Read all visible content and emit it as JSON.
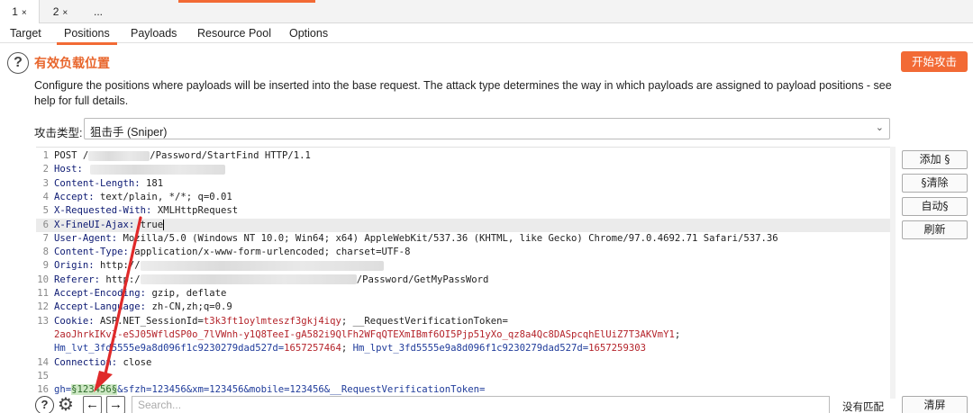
{
  "request_tabs": [
    {
      "label": "1",
      "close": "×"
    },
    {
      "label": "2",
      "close": "×"
    },
    {
      "label": "..."
    }
  ],
  "sub_tabs": [
    "Target",
    "Positions",
    "Payloads",
    "Resource Pool",
    "Options"
  ],
  "active_sub_tab": "Positions",
  "header": {
    "help_glyph": "?",
    "title": "有效负载位置",
    "start_button": "开始攻击",
    "description": "Configure the positions where payloads will be inserted into the base request. The attack type determines the way in which payloads are assigned to payload positions - see help for full details."
  },
  "attack_type": {
    "label": "攻击类型:",
    "value": "狙击手 (Sniper)"
  },
  "side_buttons": {
    "add": "添加 §",
    "clear_marks": "§清除",
    "auto": "自动§",
    "refresh": "刷新"
  },
  "request": {
    "l1_num": "1",
    "l1_method": "POST /",
    "l1_path": "/Password/StartFind HTTP/1.1",
    "l2_num": "2",
    "l2_name": "Host:",
    "l3_num": "3",
    "l3_name": "Content-Length:",
    "l3_value": " 181",
    "l4_num": "4",
    "l4_name": "Accept:",
    "l4_value": " text/plain, */*; q=0.01",
    "l5_num": "5",
    "l5_name": "X-Requested-With:",
    "l5_value": " XMLHttpRequest",
    "l6_num": "6",
    "l6_name": "X-FineUI-Ajax:",
    "l6_value": " true",
    "l7_num": "7",
    "l7_name": "User-Agent:",
    "l7_value": " Mozilla/5.0 (Windows NT 10.0; Win64; x64) AppleWebKit/537.36 (KHTML, like Gecko) Chrome/97.0.4692.71 Safari/537.36",
    "l8_num": "8",
    "l8_name": "Content-Type:",
    "l8_value": " application/x-www-form-urlencoded; charset=UTF-8",
    "l9_num": "9",
    "l9_name": "Origin:",
    "l9_value": " http://",
    "l10_num": "10",
    "l10_name": "Referer:",
    "l10_value": " http:/",
    "l10_tail": "/Password/GetMyPassWord",
    "l11_num": "11",
    "l11_name": "Accept-Encoding:",
    "l11_value": " gzip, deflate",
    "l12_num": "12",
    "l12_name": "Accept-Language:",
    "l12_value": " zh-CN,zh;q=0.9",
    "l13_num": "13",
    "l13_name": "Cookie:",
    "l13_c1": " ASP.NET_SessionId=",
    "l13_c1v": "t3k3ft1oylmteszf3gkj4iqy",
    "l13_c2": "; __RequestVerificationToken=",
    "l13b": "2aoJhrkIKvl-eSJ05WfldSP0o_7lVWnh-y1Q8TeeI-gA582i9QlFh2WFqQTEXmIBmf6OI5Pjp51yXo_qz8a4Qc8DASpcqhElUiZ7T3AKVmY1",
    "l13b_end": ";",
    "l13c_k1": "Hm_lvt_3fd5555e9a8d096f1c9230279dad527d=",
    "l13c_v1": "1657257464",
    "l13c_sep": "; ",
    "l13c_k2": "Hm_lpvt_3fd5555e9a8d096f1c9230279dad527d=",
    "l13c_v2": "1657259303",
    "l14_num": "14",
    "l14_name": "Connection:",
    "l14_value": " close",
    "l15_num": "15",
    "l16_num": "16",
    "l16_k1": "gh=",
    "l16_marker": "§123456§",
    "l16_rest": "&sfzh=123456&xm=123456&mobile=123456&__RequestVerificationToken="
  },
  "bottom": {
    "help_glyph": "?",
    "back_arrow": "←",
    "forward_arrow": "→",
    "search_placeholder": "Search...",
    "match_status": "没有匹配",
    "clear_button": "清屏"
  },
  "colors": {
    "accent": "#f26a35",
    "header_name": "#0d1a73",
    "cookie_value": "#b4232a",
    "payload_marker_bg": "#cde8c4",
    "annotation_arrow": "#e02a2a"
  }
}
